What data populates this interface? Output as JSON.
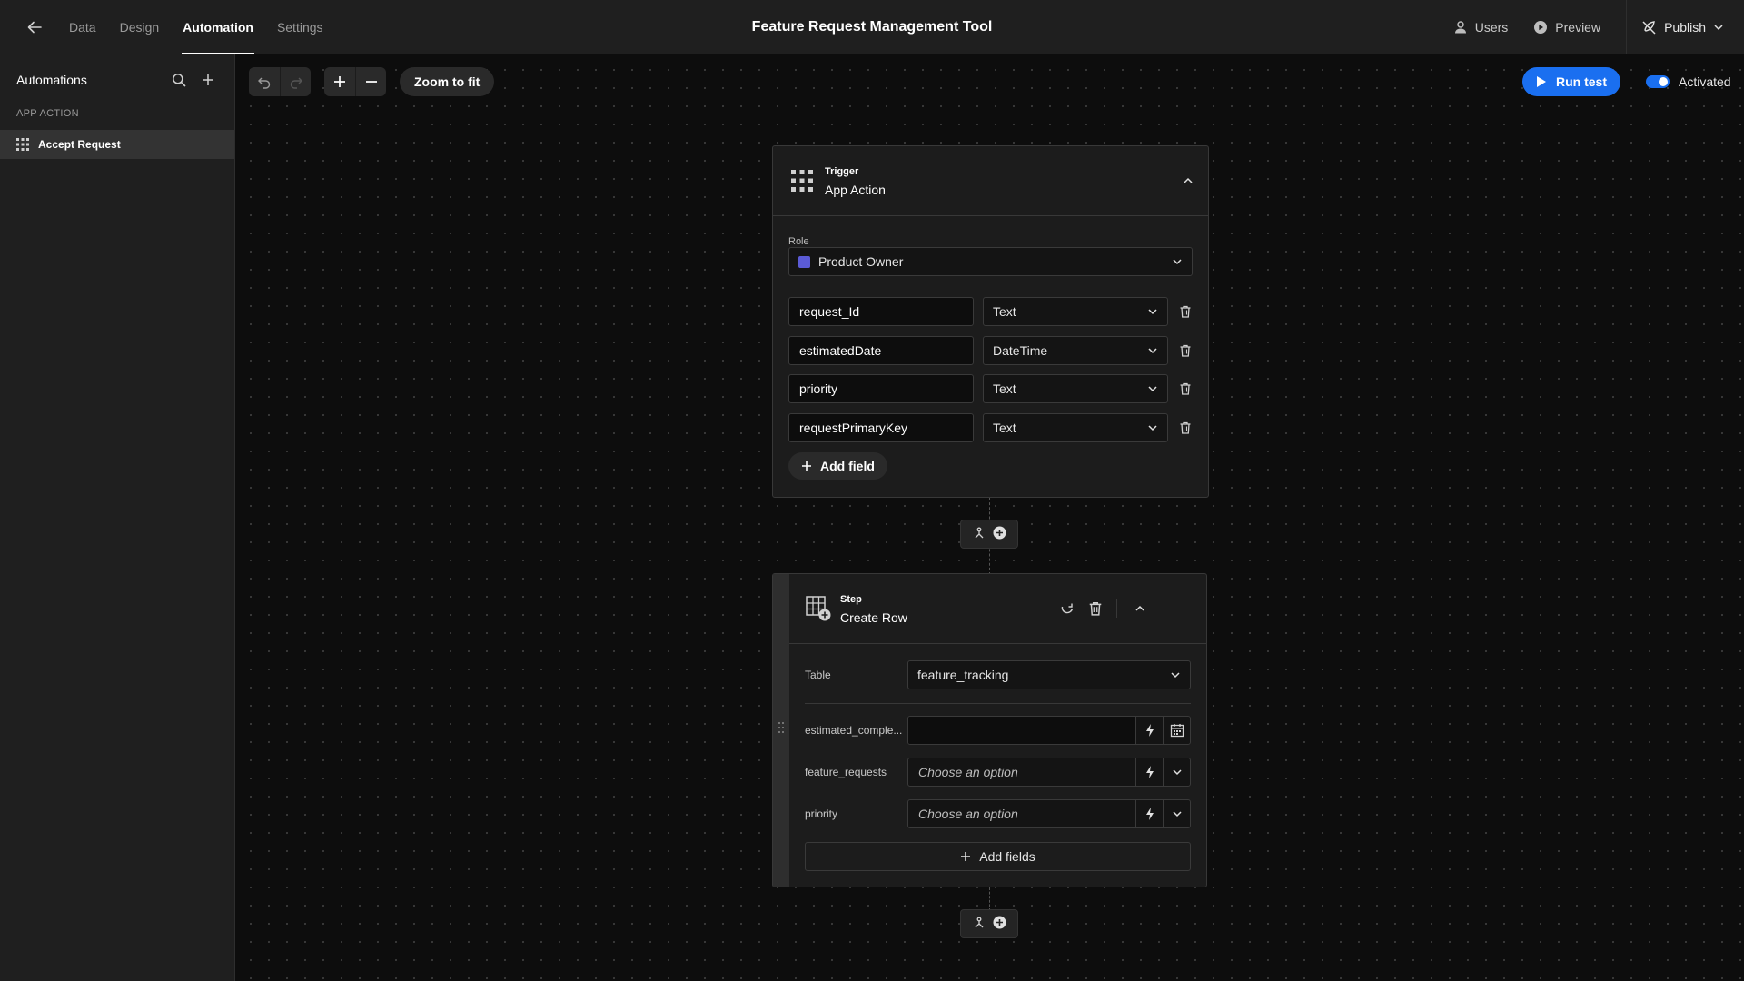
{
  "topbar": {
    "tabs": [
      {
        "label": "Data",
        "active": false
      },
      {
        "label": "Design",
        "active": false
      },
      {
        "label": "Automation",
        "active": true
      },
      {
        "label": "Settings",
        "active": false
      }
    ],
    "title": "Feature Request Management Tool",
    "users_label": "Users",
    "preview_label": "Preview",
    "publish_label": "Publish"
  },
  "sidebar": {
    "title": "Automations",
    "section": "APP ACTION",
    "items": [
      {
        "label": "Accept Request"
      }
    ]
  },
  "toolbar": {
    "zoom_fit_label": "Zoom to fit",
    "run_test_label": "Run test",
    "activated_label": "Activated"
  },
  "trigger": {
    "kicker": "Trigger",
    "heading": "App Action",
    "role_label": "Role",
    "role_value": "Product Owner",
    "role_color": "#5b5bd6",
    "fields": [
      {
        "name": "request_Id",
        "type": "Text"
      },
      {
        "name": "estimatedDate",
        "type": "DateTime"
      },
      {
        "name": "priority",
        "type": "Text"
      },
      {
        "name": "requestPrimaryKey",
        "type": "Text"
      }
    ],
    "add_field_label": "Add field"
  },
  "step": {
    "kicker": "Step",
    "heading": "Create Row",
    "table_label": "Table",
    "table_value": "feature_tracking",
    "rows": [
      {
        "label": "estimated_comple...",
        "value": "",
        "placeholder": ""
      },
      {
        "label": "feature_requests",
        "value": "",
        "placeholder": "Choose an option"
      },
      {
        "label": "priority",
        "value": "",
        "placeholder": "Choose an option"
      }
    ],
    "add_fields_label": "Add fields"
  },
  "colors": {
    "accent": "#1a6ff0",
    "background": "#0d0d0d",
    "panel": "#1f1f1f"
  }
}
